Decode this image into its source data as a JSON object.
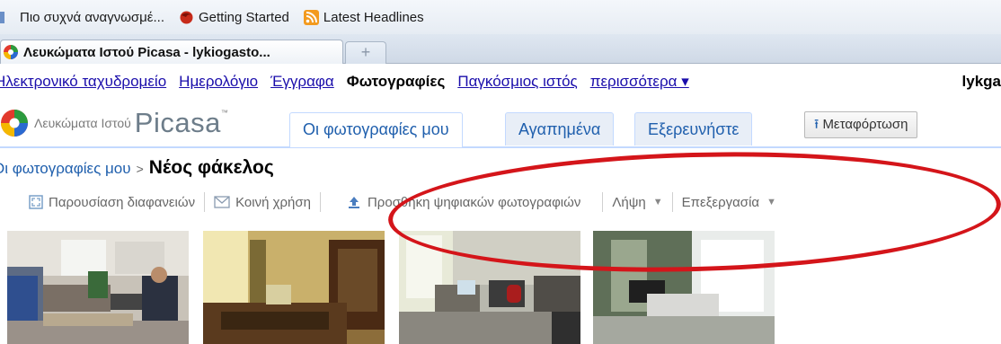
{
  "bookmarks": {
    "items": [
      {
        "label": "Πιο συχνά αναγνωσμέ...",
        "icon": "bookmark-icon"
      },
      {
        "label": "Getting Started",
        "icon": "firefox-icon"
      },
      {
        "label": "Latest Headlines",
        "icon": "rss-icon"
      }
    ]
  },
  "browser_tab": {
    "title": "Λευκώματα Ιστού Picasa - lykiogasto...",
    "new_tab": "+"
  },
  "google_bar": {
    "links": [
      "Ηλεκτρονικό ταχυδρομείο",
      "Ημερολόγιο",
      "Έγγραφα"
    ],
    "current": "Φωτογραφίες",
    "links_after": [
      "Παγκόσμιος ιστός",
      "περισσότερα ▾"
    ],
    "user": "lykga"
  },
  "picasa": {
    "logo_small": "Λευκώματα Ιστού",
    "logo_big": "Picasa",
    "logo_tm": "™",
    "tabs": [
      "Οι φωτογραφίες μου",
      "Αγαπημένα",
      "Εξερευνήστε"
    ],
    "upload_label": "Μεταφόρτωση",
    "upload_icon": "⭱"
  },
  "breadcrumb": {
    "parent": "Οι φωτογραφίες μου",
    "sep": ">",
    "title": "Νέος φάκελος"
  },
  "actions": {
    "slideshow": "Παρουσίαση διαφανειών",
    "share": "Κοινή χρήση",
    "add_photos": "Προσθήκη ψηφιακών φωτογραφιών",
    "download": "Λήψη",
    "edit": "Επεξεργασία"
  },
  "colors": {
    "link": "#1a0dab",
    "picasa_tab_text": "#1f5fad",
    "annotation_red": "#d4151a"
  }
}
